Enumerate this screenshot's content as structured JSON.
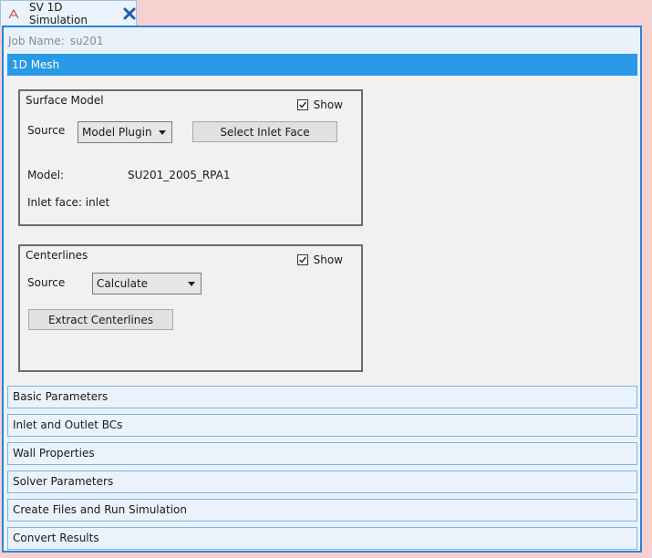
{
  "tab": {
    "title": "SV 1D Simulation",
    "icon": "app-logo-icon",
    "close_icon": "close-icon"
  },
  "job": {
    "label": "Job Name:",
    "value": "su201"
  },
  "active_section": "1D Mesh",
  "surface_model": {
    "title": "Surface Model",
    "show_label": "Show",
    "show_checked": true,
    "source_label": "Source",
    "source_value": "Model Plugin",
    "select_inlet_label": "Select Inlet Face",
    "model_label": "Model:",
    "model_value": "SU201_2005_RPA1",
    "inlet_face": "Inlet face: inlet"
  },
  "centerlines": {
    "title": "Centerlines",
    "show_label": "Show",
    "show_checked": true,
    "source_label": "Source",
    "source_value": "Calculate",
    "extract_label": "Extract Centerlines"
  },
  "sections": [
    {
      "label": "Basic Parameters"
    },
    {
      "label": "Inlet and Outlet BCs"
    },
    {
      "label": "Wall Properties"
    },
    {
      "label": "Solver Parameters"
    },
    {
      "label": "Create Files and Run Simulation"
    },
    {
      "label": "Convert Results"
    }
  ],
  "colors": {
    "accent": "#2a9ae6",
    "panel_border": "#2b85d6",
    "background": "#f7d0d0"
  }
}
